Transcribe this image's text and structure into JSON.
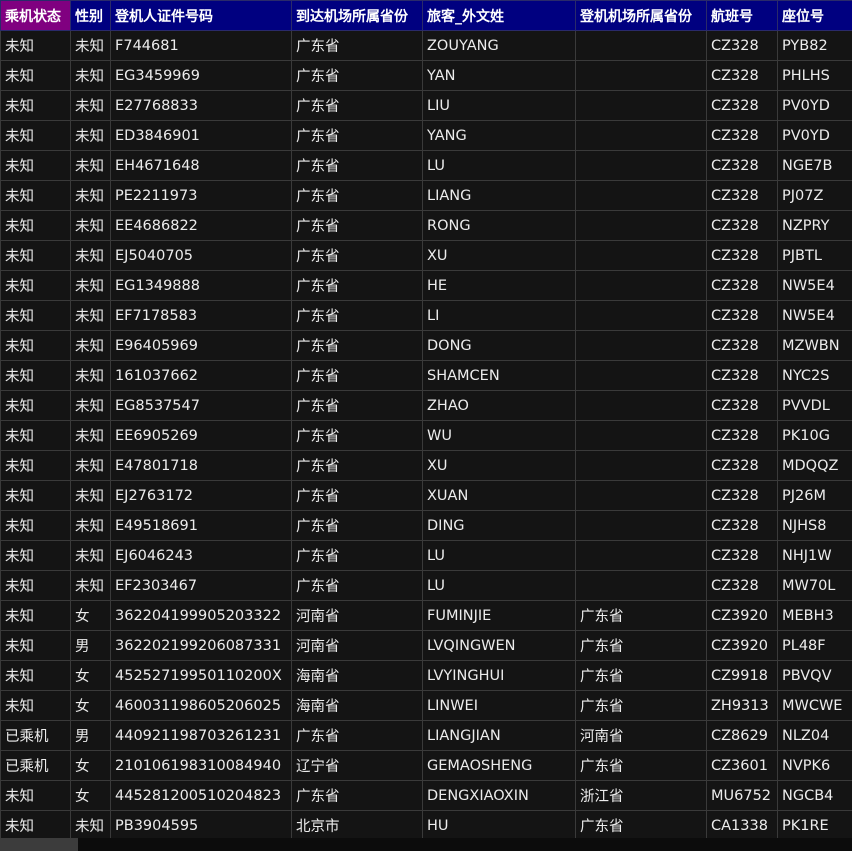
{
  "columns": [
    "乘机状态",
    "性别",
    "登机人证件号码",
    "到达机场所属省份",
    "旅客_外文姓",
    "登机机场所属省份",
    "航班号",
    "座位号"
  ],
  "rows": [
    [
      "未知",
      "未知",
      "F744681",
      "广东省",
      "ZOUYANG",
      "",
      "CZ328",
      "PYB82"
    ],
    [
      "未知",
      "未知",
      "EG3459969",
      "广东省",
      "YAN",
      "",
      "CZ328",
      "PHLHS"
    ],
    [
      "未知",
      "未知",
      "E27768833",
      "广东省",
      "LIU",
      "",
      "CZ328",
      "PV0YD"
    ],
    [
      "未知",
      "未知",
      "ED3846901",
      "广东省",
      "YANG",
      "",
      "CZ328",
      "PV0YD"
    ],
    [
      "未知",
      "未知",
      "EH4671648",
      "广东省",
      "LU",
      "",
      "CZ328",
      "NGE7B"
    ],
    [
      "未知",
      "未知",
      "PE2211973",
      "广东省",
      "LIANG",
      "",
      "CZ328",
      "PJ07Z"
    ],
    [
      "未知",
      "未知",
      "EE4686822",
      "广东省",
      "RONG",
      "",
      "CZ328",
      "NZPRY"
    ],
    [
      "未知",
      "未知",
      "EJ5040705",
      "广东省",
      "XU",
      "",
      "CZ328",
      "PJBTL"
    ],
    [
      "未知",
      "未知",
      "EG1349888",
      "广东省",
      "HE",
      "",
      "CZ328",
      "NW5E4"
    ],
    [
      "未知",
      "未知",
      "EF7178583",
      "广东省",
      "LI",
      "",
      "CZ328",
      "NW5E4"
    ],
    [
      "未知",
      "未知",
      "E96405969",
      "广东省",
      "DONG",
      "",
      "CZ328",
      "MZWBN"
    ],
    [
      "未知",
      "未知",
      "161037662",
      "广东省",
      "SHAMCEN",
      "",
      "CZ328",
      "NYC2S"
    ],
    [
      "未知",
      "未知",
      "EG8537547",
      "广东省",
      "ZHAO",
      "",
      "CZ328",
      "PVVDL"
    ],
    [
      "未知",
      "未知",
      "EE6905269",
      "广东省",
      "WU",
      "",
      "CZ328",
      "PK10G"
    ],
    [
      "未知",
      "未知",
      "E47801718",
      "广东省",
      "XU",
      "",
      "CZ328",
      "MDQQZ"
    ],
    [
      "未知",
      "未知",
      "EJ2763172",
      "广东省",
      "XUAN",
      "",
      "CZ328",
      "PJ26M"
    ],
    [
      "未知",
      "未知",
      "E49518691",
      "广东省",
      "DING",
      "",
      "CZ328",
      "NJHS8"
    ],
    [
      "未知",
      "未知",
      "EJ6046243",
      "广东省",
      "LU",
      "",
      "CZ328",
      "NHJ1W"
    ],
    [
      "未知",
      "未知",
      "EF2303467",
      "广东省",
      "LU",
      "",
      "CZ328",
      "MW70L"
    ],
    [
      "未知",
      "女",
      "362204199905203322",
      "河南省",
      "FUMINJIE",
      "广东省",
      "CZ3920",
      "MEBH3"
    ],
    [
      "未知",
      "男",
      "362202199206087331",
      "河南省",
      "LVQINGWEN",
      "广东省",
      "CZ3920",
      "PL48F"
    ],
    [
      "未知",
      "女",
      "45252719950110200X",
      "海南省",
      "LVYINGHUI",
      "广东省",
      "CZ9918",
      "PBVQV"
    ],
    [
      "未知",
      "女",
      "460031198605206025",
      "海南省",
      "LINWEI",
      "广东省",
      "ZH9313",
      "MWCWE"
    ],
    [
      "已乘机",
      "男",
      "440921198703261231",
      "广东省",
      "LIANGJIAN",
      "河南省",
      "CZ8629",
      "NLZ04"
    ],
    [
      "已乘机",
      "女",
      "210106198310084940",
      "辽宁省",
      "GEMAOSHENG",
      "广东省",
      "CZ3601",
      "NVPK6"
    ],
    [
      "未知",
      "女",
      "445281200510204823",
      "广东省",
      "DENGXIAOXIN",
      "浙江省",
      "MU6752",
      "NGCB4"
    ],
    [
      "未知",
      "未知",
      "PB3904595",
      "北京市",
      "HU",
      "广东省",
      "CA1338",
      "PK1RE"
    ]
  ],
  "selected_column": "乘机状态",
  "colors": {
    "header_bg": "#000080",
    "selected_header_bg": "#800080",
    "cell_bg": "#141414",
    "grid_line": "#3a3a3a"
  }
}
